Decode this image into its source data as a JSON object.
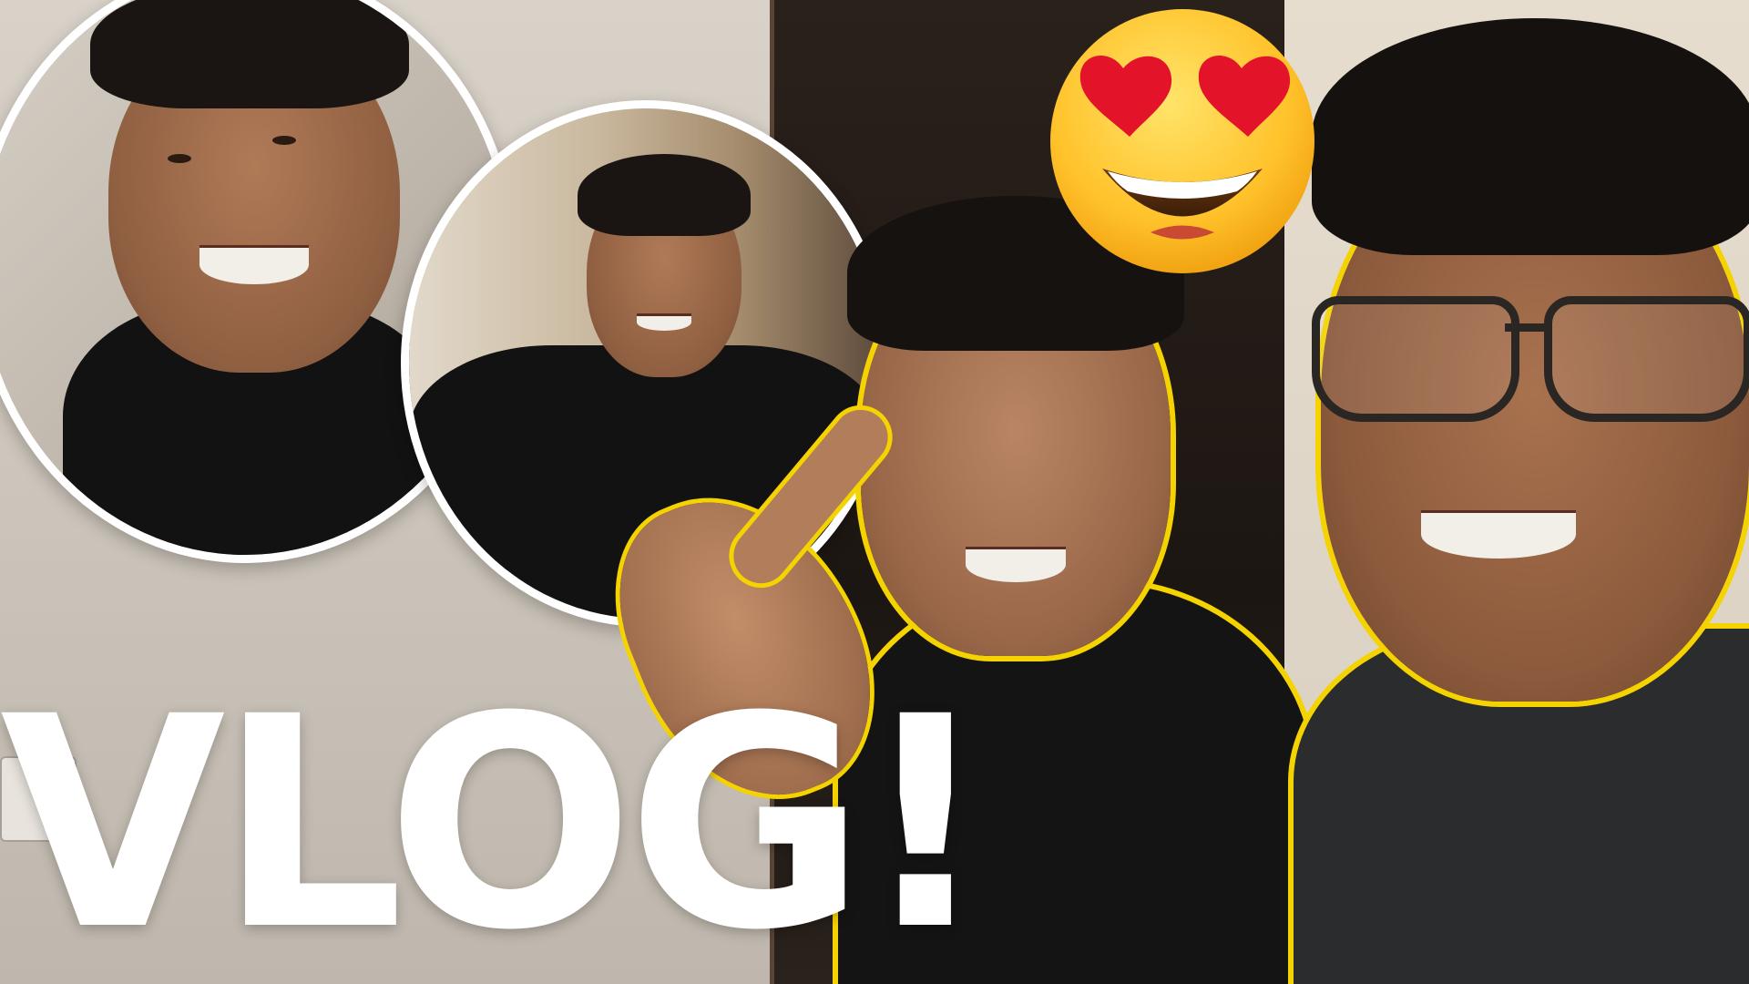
{
  "thumbnail": {
    "title_text": "VLOG!",
    "accent_color": "#f5d300",
    "title_color": "#ffffff",
    "emoji": "smiling-face-with-heart-eyes"
  }
}
